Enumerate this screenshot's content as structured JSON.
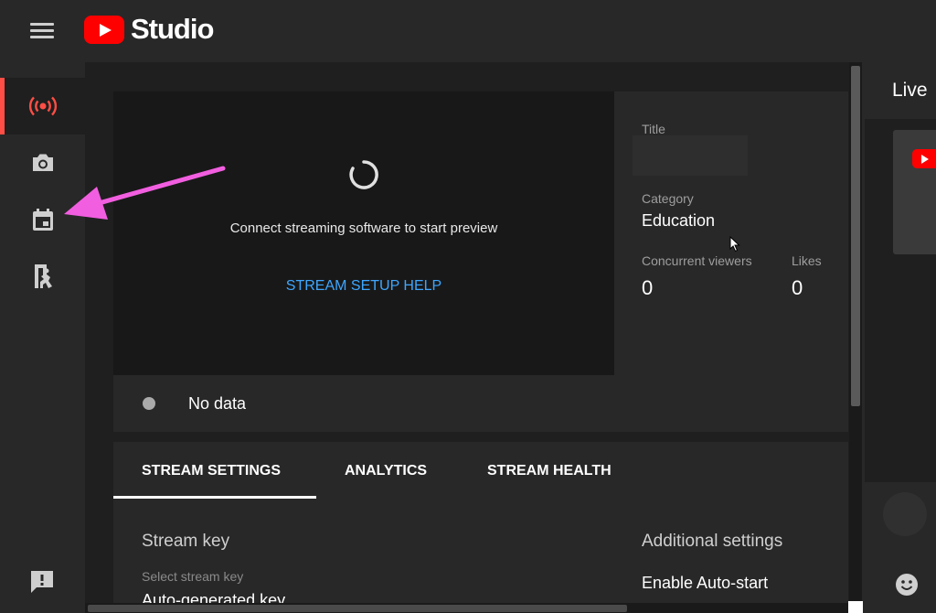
{
  "app": {
    "logo_text": "Studio"
  },
  "preview": {
    "message": "Connect streaming software to start preview",
    "help_link": "STREAM SETUP HELP"
  },
  "details": {
    "title_label": "Title",
    "title_value": "",
    "category_label": "Category",
    "category_value": "Education",
    "viewers_label": "Concurrent viewers",
    "viewers_value": "0",
    "likes_label": "Likes",
    "likes_value": "0"
  },
  "status": {
    "text": "No data"
  },
  "tabs": [
    {
      "label": "STREAM SETTINGS",
      "active": true
    },
    {
      "label": "ANALYTICS",
      "active": false
    },
    {
      "label": "STREAM HEALTH",
      "active": false
    }
  ],
  "stream_settings": {
    "stream_key_title": "Stream key",
    "select_label": "Select stream key",
    "selected_key": "Auto-generated key",
    "additional_title": "Additional settings",
    "auto_start_label": "Enable Auto-start"
  },
  "right_panel": {
    "header": "Live"
  },
  "sidebar": {
    "items": [
      {
        "icon": "live-broadcast-icon",
        "active": true
      },
      {
        "icon": "camera-icon",
        "active": false
      },
      {
        "icon": "calendar-icon",
        "active": false
      },
      {
        "icon": "stream-manager-icon",
        "active": false
      }
    ]
  },
  "colors": {
    "accent_red": "#ff4e45",
    "link_blue": "#3ea6ff",
    "annotation_arrow": "#f25ee0",
    "youtube_red": "#ff0000"
  }
}
